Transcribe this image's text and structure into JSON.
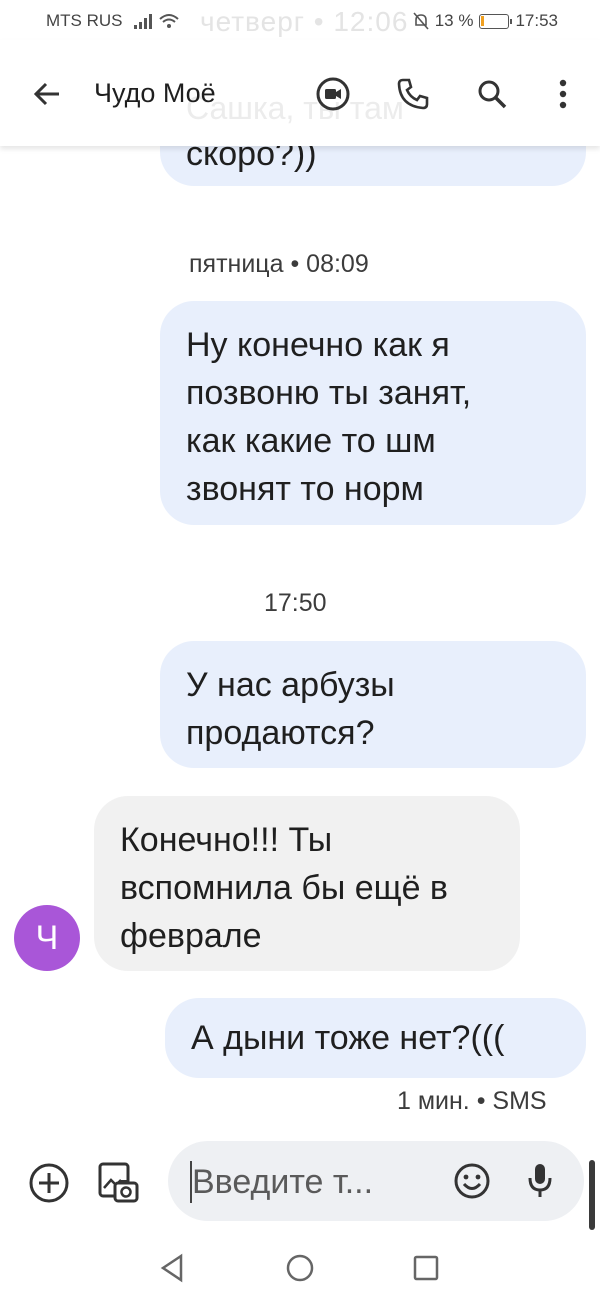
{
  "status_bar": {
    "carrier": "MTS RUS",
    "ghost_text": "четверг • 12:06",
    "battery_percent": "13 %",
    "battery_level": 0.13,
    "time": "17:53"
  },
  "toolbar": {
    "title": "Чудо Моё",
    "ghost_message": "Сашка, ты там"
  },
  "messages": [
    {
      "type": "out",
      "lines": [
        "скоро?))"
      ]
    },
    {
      "type": "timestamp",
      "text": "пятница • 08:09"
    },
    {
      "type": "out",
      "lines": [
        "Ну конечно как я",
        "позвоню ты занят,",
        "как какие то шм",
        "звонят то норм"
      ]
    },
    {
      "type": "timestamp",
      "text": "17:50"
    },
    {
      "type": "out",
      "lines": [
        "У нас арбузы",
        "продаются?"
      ]
    },
    {
      "type": "in",
      "lines": [
        "Конечно!!! Ты",
        "вспомнила бы ещё в",
        "феврале"
      ]
    },
    {
      "type": "out",
      "lines": [
        "А дыни тоже нет?((("
      ]
    },
    {
      "type": "meta",
      "text": "1 мин. • SMS"
    }
  ],
  "avatar": {
    "letter": "Ч",
    "color": "#a956d8"
  },
  "composer": {
    "placeholder": "Введите т..."
  },
  "colors": {
    "outgoing_bubble": "#e8effc",
    "incoming_bubble": "#f1f1f1"
  }
}
